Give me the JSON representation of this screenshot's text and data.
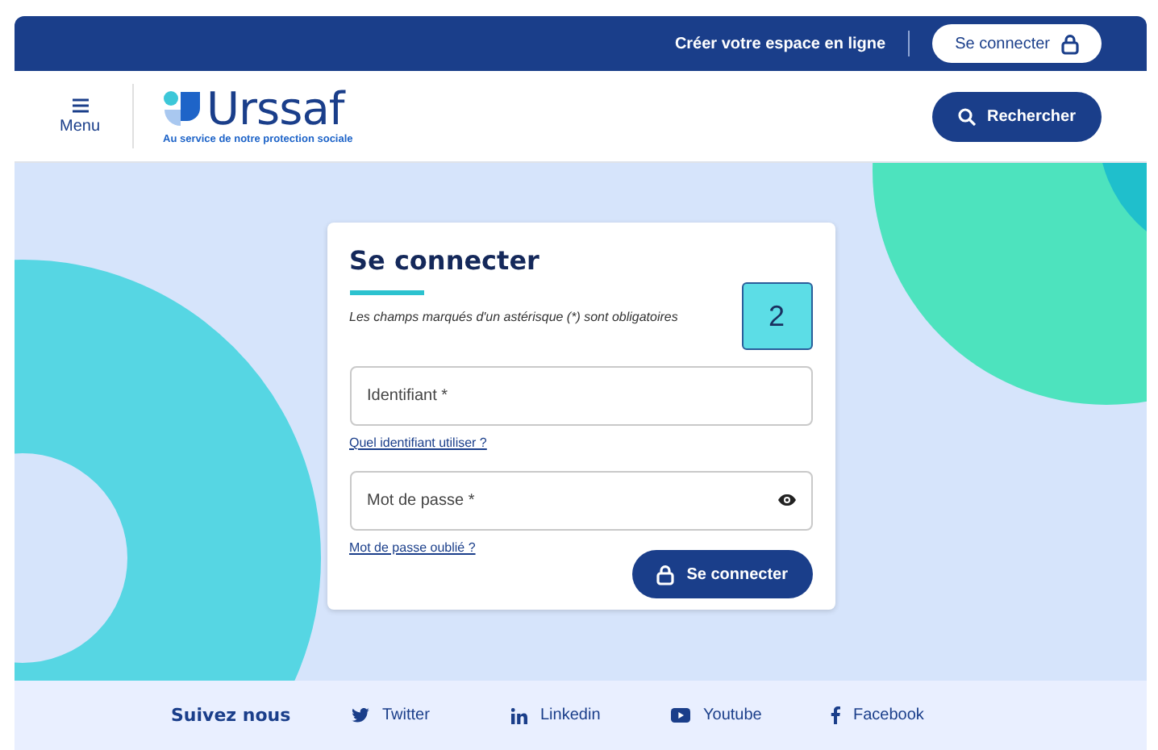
{
  "top_bar": {
    "link": "Créer votre espace en ligne",
    "button": "Se connecter"
  },
  "header": {
    "menu": "Menu",
    "logo": "Urssaf",
    "tagline": "Au service de notre protection sociale",
    "search_button": "Rechercher"
  },
  "login": {
    "title": "Se connecter",
    "note": "Les champs marqués d'un astérisque (*) sont obligatoires",
    "badge": "2",
    "fields": [
      {
        "placeholder": "Identifiant *",
        "kind": "text",
        "help": "Quel identifiant utiliser ?"
      },
      {
        "placeholder": "Mot de passe *",
        "kind": "password",
        "help": "Mot de passe oublié ?"
      }
    ],
    "submit": "Se connecter"
  },
  "footer": {
    "title": "Suivez nous",
    "links": [
      {
        "label": "Twitter",
        "kind": "bird"
      },
      {
        "label": "Linkedin",
        "kind": "in"
      },
      {
        "label": "Youtube",
        "kind": "play"
      },
      {
        "label": "Facebook",
        "kind": "f"
      }
    ]
  }
}
